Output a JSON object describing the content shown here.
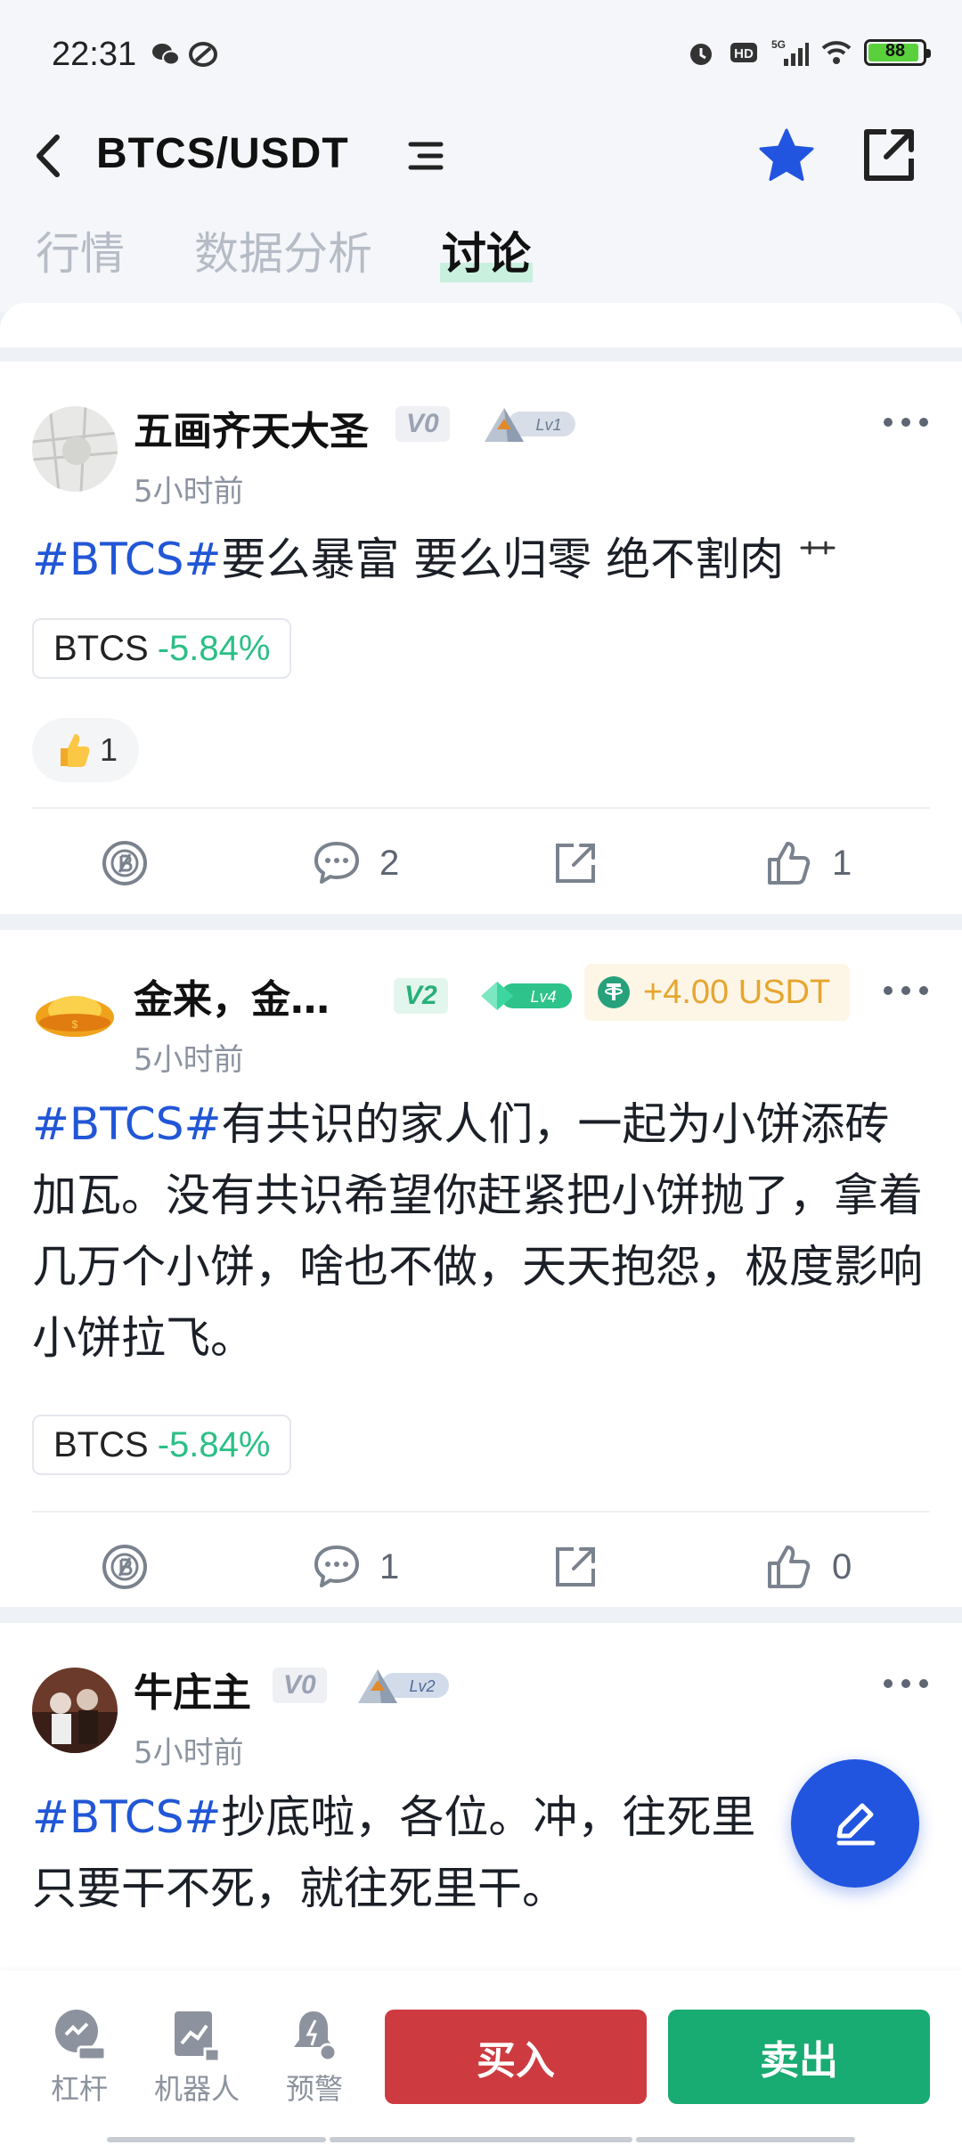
{
  "status_bar": {
    "time": "22:31",
    "battery": "88"
  },
  "header": {
    "pair": "BTCS/USDT"
  },
  "tabs": [
    {
      "label": "行情"
    },
    {
      "label": "数据分析"
    },
    {
      "label": "讨论"
    }
  ],
  "posts": [
    {
      "username": "五画齐天大圣",
      "vip": "V0",
      "level": "Lv1",
      "time": "5小时前",
      "tag": "#BTCS#",
      "text": "要么暴富 要么归零   绝不割肉 ",
      "coin": {
        "symbol": "BTCS",
        "change": "-5.84%"
      },
      "reaction_count": "1",
      "comments": "2",
      "likes": "1"
    },
    {
      "username": "金来，金…",
      "vip": "V2",
      "level": "Lv4",
      "tip": "+4.00 USDT",
      "time": "5小时前",
      "tag": "#BTCS#",
      "text": "有共识的家人们，一起为小饼添砖加瓦。没有共识希望你赶紧把小饼抛了，拿着几万个小饼，啥也不做，天天抱怨，极度影响小饼拉飞。",
      "coin": {
        "symbol": "BTCS",
        "change": "-5.84%"
      },
      "comments": "1",
      "likes": "0"
    },
    {
      "username": "牛庄主",
      "vip": "V0",
      "level": "Lv2",
      "time": "5小时前",
      "tag": "#BTCS#",
      "text": "抄底啦，各位。冲，往死里",
      "text2": "只要干不死，就往死里干。"
    }
  ],
  "bottom_nav": [
    {
      "label": "杠杆"
    },
    {
      "label": "机器人"
    },
    {
      "label": "预警"
    }
  ],
  "buy_label": "买入",
  "sell_label": "卖出",
  "colors": {
    "buy": "#cd3b40",
    "sell": "#18ab72",
    "accent": "#2155e0",
    "tag": "#2156d6",
    "down": "#2cbf86"
  }
}
